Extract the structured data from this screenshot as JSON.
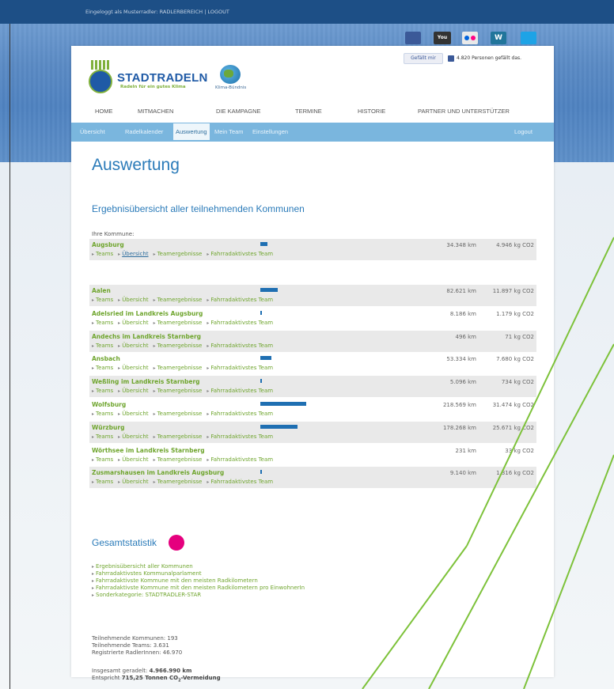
{
  "topbar": {
    "login_text": "Eingeloggt als Musterradler: RADLERBEREICH | LOGOUT"
  },
  "social": {
    "youtube_label": "You",
    "wordpress_label": "W"
  },
  "header": {
    "logo_title": "STADTRADELN",
    "logo_subtitle": "Radeln für ein gutes Klima",
    "partner_logo_text": "Klima-Bündnis",
    "like_button": "Gefällt mir",
    "like_text": "4.820 Personen gefällt das."
  },
  "nav": {
    "home": "HOME",
    "mitmachen": "MITMACHEN",
    "kampagne": "DIE KAMPAGNE",
    "termine": "TERMINE",
    "historie": "HISTORIE",
    "partner": "PARTNER UND UNTERSTÜTZER"
  },
  "subnav": {
    "uebersicht": "Übersicht",
    "radelkalender": "Radelkalender",
    "auswertung": "Auswertung",
    "mein_team": "Mein Team",
    "einstellungen": "Einstellungen",
    "logout": "Logout"
  },
  "page": {
    "title": "Auswertung",
    "section_title": "Ergebnisübersicht aller teilnehmenden Kommunen",
    "ihre_kommune_label": "Ihre Kommune:"
  },
  "row_links": {
    "teams": "Teams",
    "uebersicht": "Übersicht",
    "teamergebnisse": "Teamergebnisse",
    "fahrradaktivstes": "Fahrradaktivstes Team"
  },
  "own_kommune": {
    "name": "Augsburg",
    "km": "34.348 km",
    "co2": "4.946 kg CO2",
    "share": 0.157
  },
  "kommunen": [
    {
      "name": "Aalen",
      "km": "82.621 km",
      "co2": "11.897 kg CO2",
      "share": 0.378
    },
    {
      "name": "Adelsried im Landkreis Augsburg",
      "km": "8.186 km",
      "co2": "1.179 kg CO2",
      "share": 0.037
    },
    {
      "name": "Andechs im Landkreis Starnberg",
      "km": "496 km",
      "co2": "71 kg CO2",
      "share": 0.0
    },
    {
      "name": "Ansbach",
      "km": "53.334 km",
      "co2": "7.680 kg CO2",
      "share": 0.244
    },
    {
      "name": "Weßling im Landkreis Starnberg",
      "km": "5.096 km",
      "co2": "734 kg CO2",
      "share": 0.023
    },
    {
      "name": "Wolfsburg",
      "km": "218.569 km",
      "co2": "31.474 kg CO2",
      "share": 1.0
    },
    {
      "name": "Würzburg",
      "km": "178.268 km",
      "co2": "25.671 kg CO2",
      "share": 0.816
    },
    {
      "name": "Wörthsee im Landkreis Starnberg",
      "km": "231 km",
      "co2": "33 kg CO2",
      "share": 0.0
    },
    {
      "name": "Zusmarshausen im Landkreis Augsburg",
      "km": "9.140 km",
      "co2": "1.316 kg CO2",
      "share": 0.042
    }
  ],
  "gesamt": {
    "title": "Gesamtstatistik",
    "links": [
      "Ergebnisübersicht aller Kommunen",
      "Fahrradaktivstes Kommunalparlament",
      "Fahrradaktivste Kommune mit den meisten Radkilometern",
      "Fahrradaktivste Kommune mit den meisten Radkilometern pro EinwohnerIn",
      "Sonderkategorie: STADTRADLER-STAR"
    ],
    "teilnehmende_kommunen": "Teilnehmende Kommunen: 193",
    "teilnehmende_teams": "Teilnehmende Teams: 3.631",
    "registrierte": "Registrierte RadlerInnen: 46.970",
    "insgesamt_label": "Insgesamt geradelt: ",
    "insgesamt_value": "4.966.990 km",
    "entspricht_label": "Entspricht ",
    "entspricht_value": "715,25 Tonnen CO",
    "entspricht_sub": "2",
    "entspricht_suffix": "-Vermeidung"
  },
  "colors": {
    "accent": "#2b7bb9",
    "link_green": "#6fa52e",
    "bar": "#1f6fb2",
    "marker": "#e5007e"
  }
}
